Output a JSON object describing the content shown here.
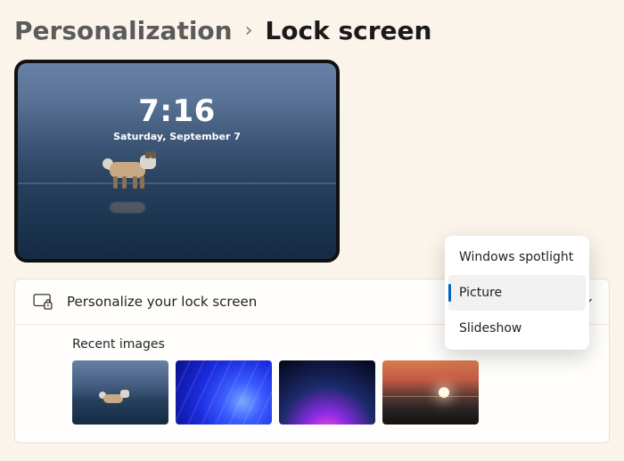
{
  "breadcrumb": {
    "parent": "Personalization",
    "separator": "›",
    "current": "Lock screen"
  },
  "preview": {
    "time": "7:16",
    "date": "Saturday, September 7"
  },
  "section": {
    "title": "Personalize your lock screen",
    "icon": "lockscreen-icon"
  },
  "recent": {
    "label": "Recent images",
    "thumbs": [
      {
        "name": "wolf-on-water"
      },
      {
        "name": "blue-abstract"
      },
      {
        "name": "purple-bloom"
      },
      {
        "name": "sunset-horizon"
      }
    ]
  },
  "dropdown": {
    "items": [
      {
        "label": "Windows spotlight",
        "selected": false
      },
      {
        "label": "Picture",
        "selected": true
      },
      {
        "label": "Slideshow",
        "selected": false
      }
    ]
  }
}
